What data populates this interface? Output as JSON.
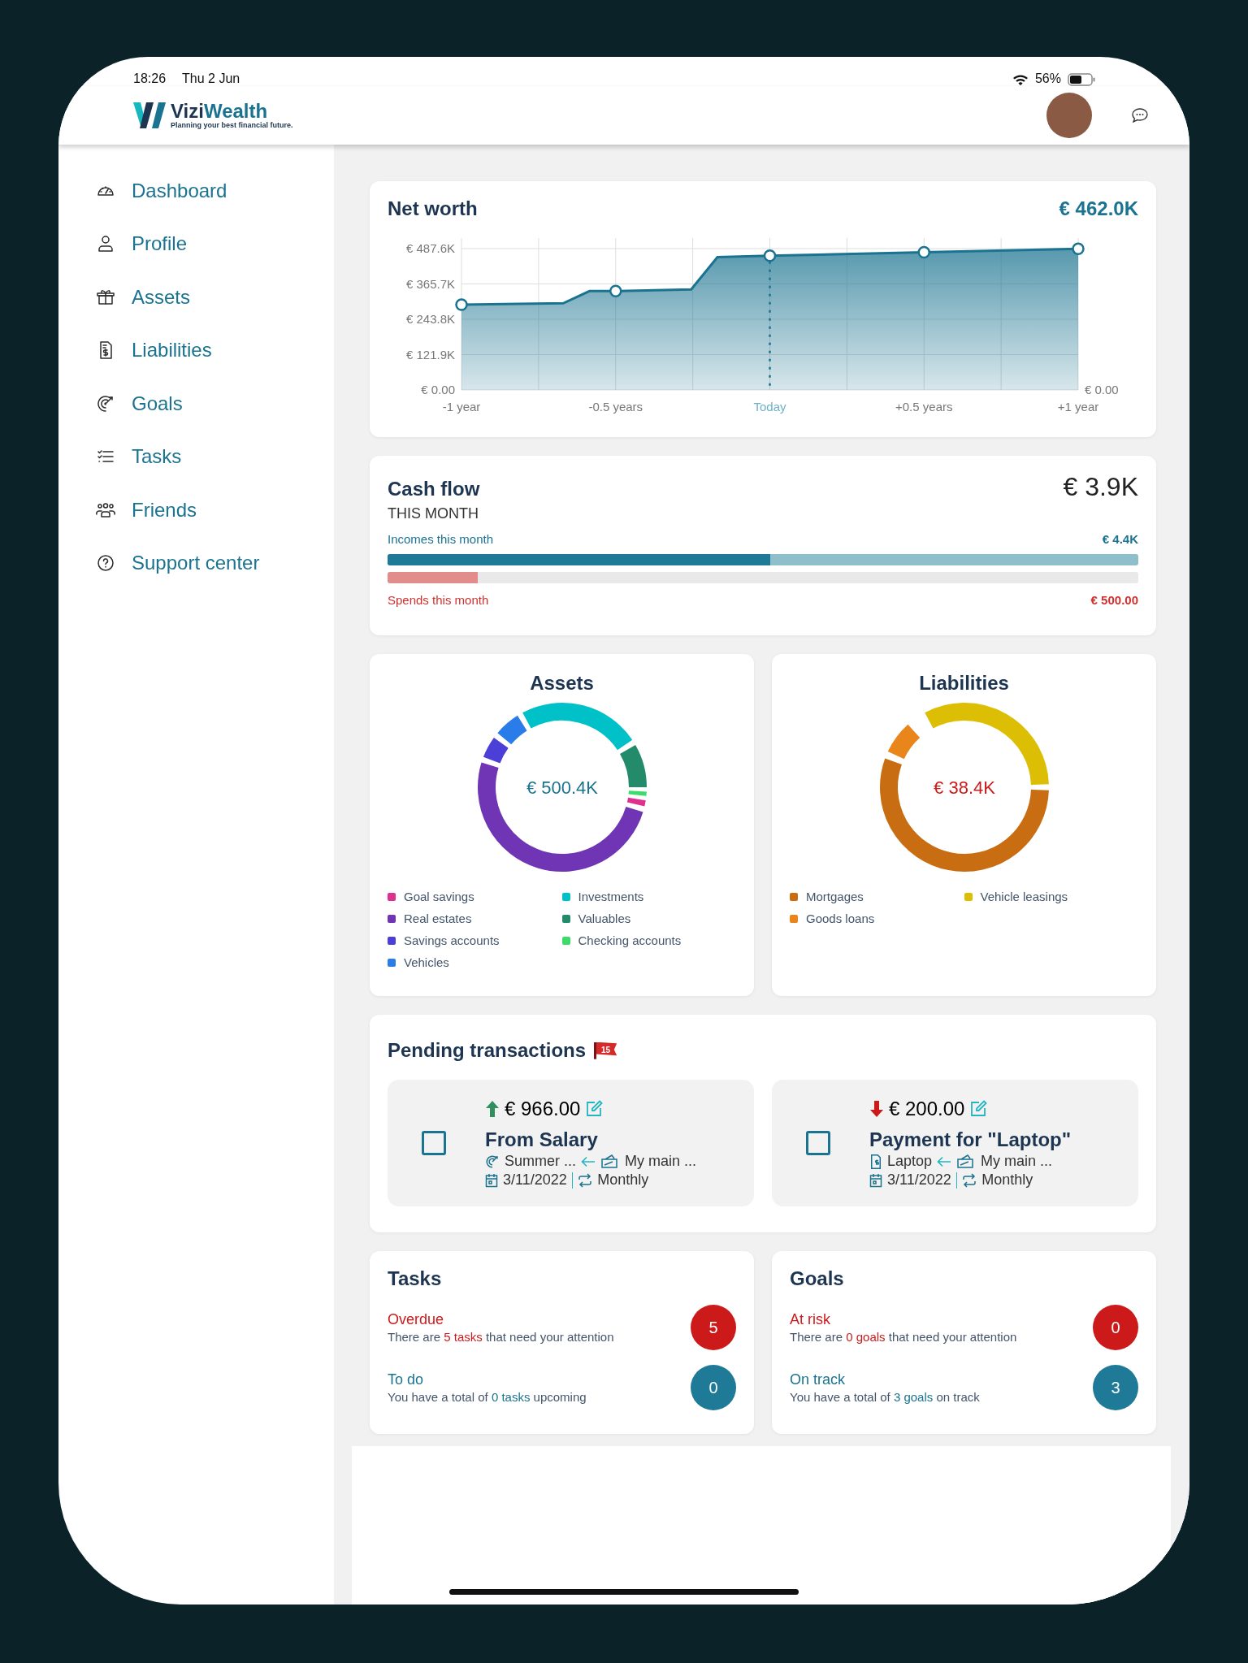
{
  "status_bar": {
    "time": "18:26",
    "date": "Thu 2 Jun",
    "battery": "56%"
  },
  "header": {
    "brand_parts": [
      "Vizi",
      "Wealth"
    ],
    "tagline": "Planning your best financial future."
  },
  "sidebar": {
    "items": [
      "Dashboard",
      "Profile",
      "Assets",
      "Liabilities",
      "Goals",
      "Tasks",
      "Friends",
      "Support center"
    ]
  },
  "net_worth": {
    "title": "Net worth",
    "value": "€ 462.0K",
    "right_axis_label": "€ 0.00",
    "chart_data": {
      "type": "area",
      "grid": true,
      "ref_lines": [
        {
          "axis": "x",
          "value": 0
        }
      ],
      "xlim": [
        -1,
        1
      ],
      "ylim": [
        0,
        487.6
      ],
      "x": [
        -1,
        -0.67,
        -0.585,
        -0.5,
        -0.255,
        -0.17,
        0,
        0.5,
        1
      ],
      "series": [
        {
          "color": "#1a7390",
          "values": [
            294,
            299,
            341,
            341,
            347,
            458,
            463,
            475,
            487
          ]
        }
      ],
      "xticks": [
        {
          "value": -1,
          "label": "-1 year"
        },
        {
          "value": -0.5,
          "label": "-0.5 years"
        },
        {
          "value": 0,
          "label": "Today"
        },
        {
          "value": 0.5,
          "label": "+0.5 years"
        },
        {
          "value": 1,
          "label": "+1 year"
        }
      ],
      "yticks": [
        {
          "value": 0,
          "label": "€ 0.00"
        },
        {
          "value": 121.9,
          "label": "€ 121.9K"
        },
        {
          "value": 243.8,
          "label": "€ 243.8K"
        },
        {
          "value": 365.7,
          "label": "€ 365.7K"
        },
        {
          "value": 487.6,
          "label": "€ 487.6K"
        }
      ]
    }
  },
  "cash_flow": {
    "title": "Cash flow",
    "value": "€ 3.9K",
    "period": "THIS MONTH",
    "incomes": {
      "label": "Incomes this month",
      "value": "€ 4.4K",
      "level": 0.51
    },
    "spends": {
      "label": "Spends this month",
      "value": "€ 500.00",
      "level": 0.12
    }
  },
  "assets": {
    "title": "Assets",
    "total": "€ 500.4K",
    "legend": [
      {
        "label": "Goal savings",
        "color": "#e0308f"
      },
      {
        "label": "Investments",
        "color": "#00c0c8"
      },
      {
        "label": "Real estates",
        "color": "#6f35b5"
      },
      {
        "label": "Valuables",
        "color": "#238a6a"
      },
      {
        "label": "Savings accounts",
        "color": "#4b3fd8"
      },
      {
        "label": "Checking accounts",
        "color": "#3ddc6a"
      },
      {
        "label": "Vehicles",
        "color": "#2a7de8"
      }
    ]
  },
  "liabilities": {
    "title": "Liabilities",
    "total": "€ 38.4K",
    "legend": [
      {
        "label": "Mortgages",
        "color": "#c96d12"
      },
      {
        "label": "Vehicle leasings",
        "color": "#dcbf05"
      },
      {
        "label": "Goods loans",
        "color": "#e8861c"
      }
    ]
  },
  "pending": {
    "title": "Pending transactions",
    "count": "15",
    "transactions": [
      {
        "kind": "income",
        "checked": false,
        "amount": "€ 966.00",
        "title": "From Salary",
        "source": {
          "kind": "goal",
          "label": "Summer ..."
        },
        "account": "My main ...",
        "date": "3/11/2022",
        "recurrence": "Monthly"
      },
      {
        "kind": "expense",
        "checked": false,
        "amount": "€ 200.00",
        "title": "Payment for \"Laptop\"",
        "source": {
          "kind": "liability",
          "label": "Laptop"
        },
        "account": "My main ...",
        "date": "3/11/2022",
        "recurrence": "Monthly"
      }
    ]
  },
  "tasks": {
    "title": "Tasks",
    "items": [
      {
        "kind": "alert",
        "label": "Overdue",
        "text_before": "There are ",
        "highlight": "5 tasks",
        "text_after": " that need your attention",
        "count": "5"
      },
      {
        "kind": "info",
        "label": "To do",
        "text_before": "You have a total of ",
        "highlight": "0 tasks",
        "text_after": " upcoming",
        "count": "0"
      }
    ]
  },
  "goals": {
    "title": "Goals",
    "items": [
      {
        "kind": "alert",
        "label": "At risk",
        "text_before": "There are ",
        "highlight": "0 goals",
        "text_after": " that need your attention",
        "count": "0"
      },
      {
        "kind": "info",
        "label": "On track",
        "text_before": "You have a total of ",
        "highlight": "3 goals",
        "text_after": " on track",
        "count": "3"
      }
    ]
  }
}
